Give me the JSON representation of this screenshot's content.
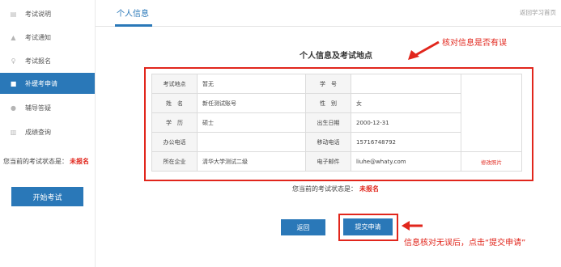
{
  "sidebar": {
    "items": [
      {
        "label": "考试说明",
        "icon": "document-icon"
      },
      {
        "label": "考试通知",
        "icon": "bell-icon"
      },
      {
        "label": "考试报名",
        "icon": "user-icon"
      },
      {
        "label": "补缓考申请",
        "icon": "form-icon",
        "active": true
      },
      {
        "label": "辅导答疑",
        "icon": "question-icon"
      },
      {
        "label": "成绩查询",
        "icon": "chart-icon"
      }
    ],
    "status_label": "您当前的考试状态是：",
    "status_value": "未报名",
    "start_button": "开始考试"
  },
  "header": {
    "tab": "个人信息",
    "back_home": "返回学习首页"
  },
  "main": {
    "section_title": "个人信息及考试地点",
    "table": {
      "r1": {
        "l1": "考试地点",
        "v1": "暂无",
        "l2": "学　号",
        "v2": ""
      },
      "r2": {
        "l1": "姓　名",
        "v1": "新任测试账号",
        "l2": "性　别",
        "v2": "女"
      },
      "r3": {
        "l1": "学　历",
        "v1": "硕士",
        "l2": "出生日期",
        "v2": "2000-12-31"
      },
      "r4": {
        "l1": "办公电话",
        "v1": "",
        "l2": "移动电话",
        "v2": "15716748792"
      },
      "r5": {
        "l1": "所在企业",
        "v1": "清华大学测试二级",
        "l2": "电子邮件",
        "v2": "liuhe@whaty.com"
      },
      "photo_link": "修改照片"
    },
    "status_label": "您当前的考试状态是：",
    "status_value": "未报名",
    "back_button": "返回",
    "submit_button": "提交申请"
  },
  "annotations": {
    "check_info": "核对信息是否有误",
    "submit_hint": "信息核对无误后，点击“提交申请”"
  },
  "colors": {
    "accent": "#2a78b8",
    "alert": "#e1261c"
  }
}
